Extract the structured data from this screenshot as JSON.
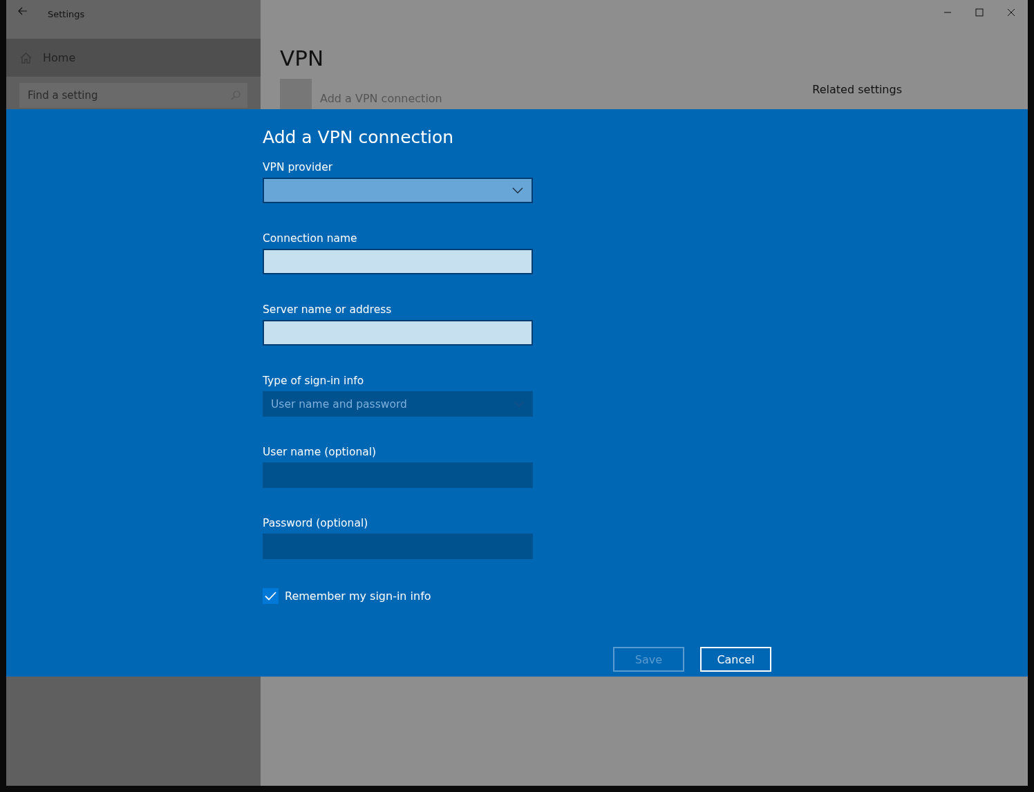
{
  "window": {
    "title": "Settings"
  },
  "sidebar": {
    "home": "Home",
    "search": {
      "placeholder": "Find a setting"
    }
  },
  "page": {
    "title": "VPN",
    "add_vpn": "Add a VPN connection",
    "related_settings": "Related settings"
  },
  "dialog": {
    "title": "Add a VPN connection",
    "fields": [
      {
        "label": "VPN provider",
        "kind": "dropdown",
        "disabled": false
      },
      {
        "label": "Connection name",
        "kind": "text",
        "disabled": false
      },
      {
        "label": "Server name or address",
        "kind": "text",
        "disabled": false
      },
      {
        "label": "Type of sign-in info",
        "kind": "dropdown",
        "disabled": true,
        "value": "User name and password"
      },
      {
        "label": "User name (optional)",
        "kind": "text",
        "disabled": true
      },
      {
        "label": "Password (optional)",
        "kind": "password",
        "disabled": true
      }
    ],
    "remember": {
      "label": "Remember my sign-in info",
      "checked": true
    },
    "buttons": [
      {
        "label": "Save",
        "disabled": true
      },
      {
        "label": "Cancel",
        "disabled": false
      }
    ]
  }
}
